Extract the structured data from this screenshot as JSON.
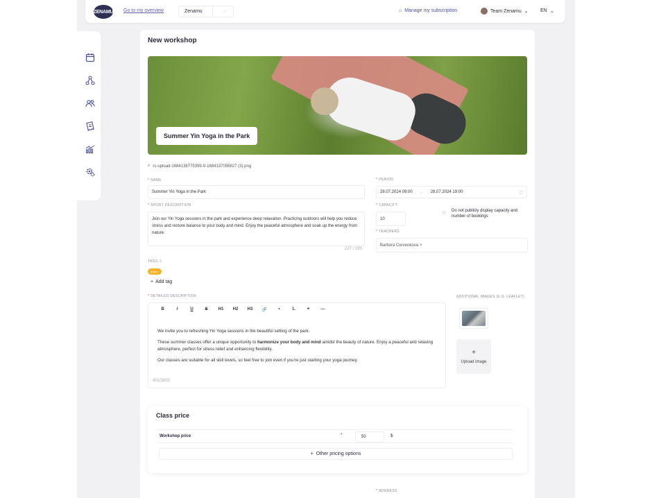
{
  "header": {
    "logo_text": "ZENAMU",
    "overview_link": "Go to my overview",
    "studio_tab": "Zenamu",
    "studio_more": "···",
    "subscription_label": "Manage my subscription",
    "team_label": "Team Zenamu",
    "language": "EN"
  },
  "sidebar": {
    "items": [
      {
        "icon": "calendar-icon"
      },
      {
        "icon": "hierarchy-icon"
      },
      {
        "icon": "people-icon"
      },
      {
        "icon": "receipt-icon"
      },
      {
        "icon": "chart-icon"
      },
      {
        "icon": "settings-gear-icon"
      }
    ]
  },
  "page": {
    "title": "New workshop",
    "banner_title": "Summer Yin Yoga in the Park",
    "file_name": "rc-upload-1684136775399-9-1684137056827 (3).png"
  },
  "form": {
    "name_label": "NAME",
    "name_value": "Summer Yin Yoga in the Park",
    "short_desc_label": "SHORT DESCRIPTION",
    "short_desc_value": "Join our Yin Yoga sessions in the park and experience deep relaxation. Practicing outdoors will help you reduce stress and restore balance to your body and mind. Enjoy the peaceful atmosphere and soak up the energy from nature.",
    "short_desc_counter": "227 / 330",
    "period_label": "PERIOD",
    "period_start": "28.07.2024 09:00",
    "period_arrow": "→",
    "period_end": "28.07.2024 19:00",
    "capacity_label": "CAPACITY",
    "capacity_value": "10",
    "capacity_checkbox_label": "Do not publicly display capacity and number of bookings",
    "teachers_label": "TEACHERS",
    "teacher_chip": "Barbora Cervenkova",
    "tags_label": "TAGS",
    "tag_value": "yoga",
    "add_tag": "Add tag",
    "detailed_label": "DETAILED DESCRIPTION",
    "additional_images_label": "ADDITIONAL IMAGES (E.G. LEAFLET)",
    "upload_image": "Upload image"
  },
  "editor": {
    "toolbar": [
      "B",
      "I",
      "U",
      "S",
      "H1",
      "H2",
      "H3",
      "🔗",
      "•",
      "1.",
      "❝",
      "—"
    ],
    "para1": "We invite you to refreshing Yin Yoga sessions in the beautiful setting of the park.",
    "para2_pre": "These summer classes offer a unique opportunity to ",
    "para2_bold": "harmonize your body and mind",
    "para2_post": " amidst the beauty of nature. Enjoy a peaceful and relaxing atmosphere, perfect for stress relief and enhancing flexibility.",
    "para3": "Our classes are suitable for all skill levels, so feel free to join even if you're just starting your yoga journey.",
    "counter": "401/3000"
  },
  "price": {
    "title": "Class price",
    "workshop_price_label": "Workshop price",
    "required_mark": "*",
    "workshop_price_value": "50",
    "currency": "$",
    "other_pricing": "Other pricing options"
  },
  "footer": {
    "address_label": "ADDRESS"
  }
}
